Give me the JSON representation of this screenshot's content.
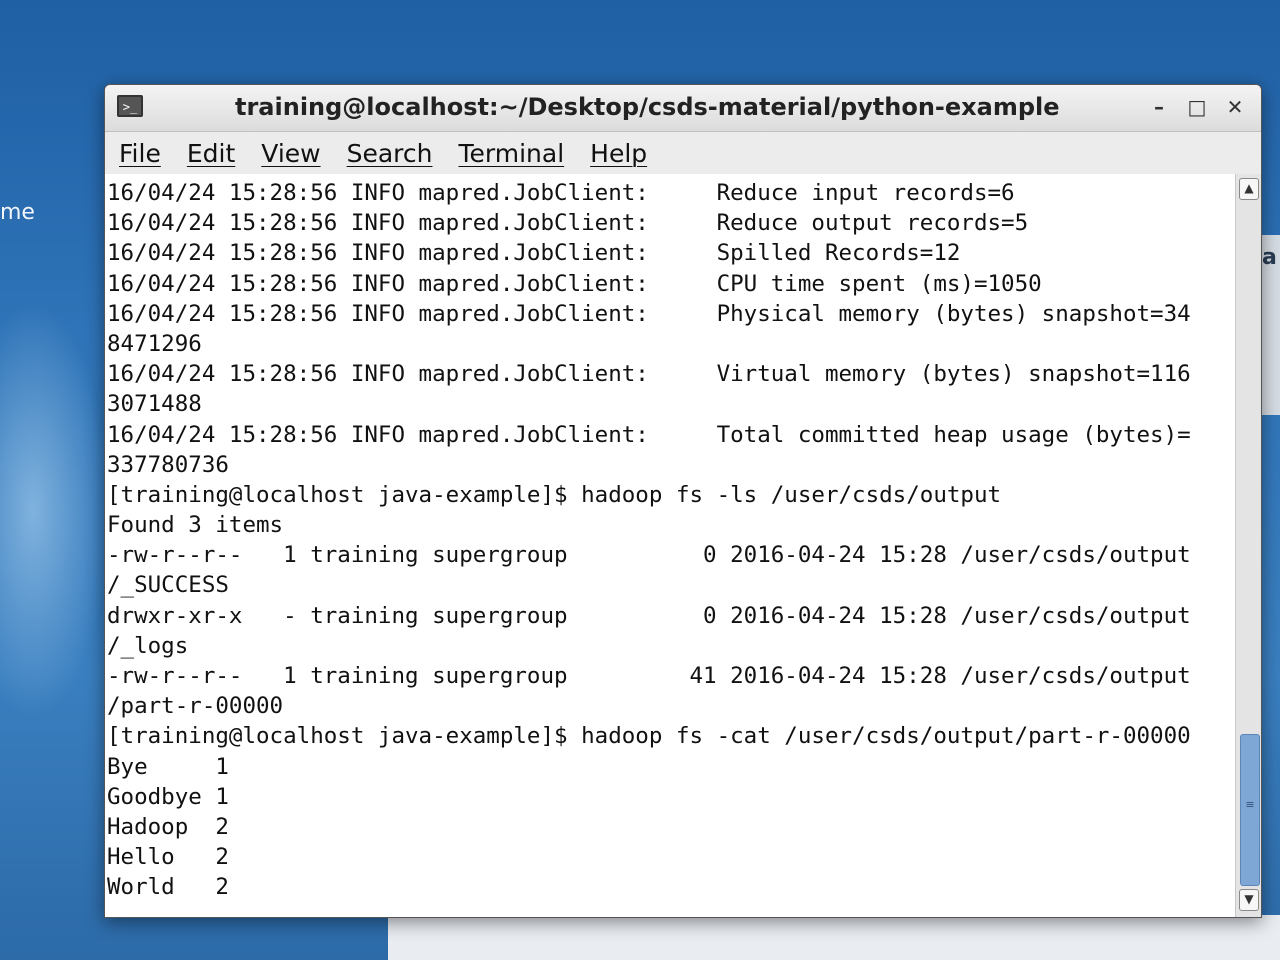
{
  "desktop": {
    "left_text": "me",
    "right_text": "a"
  },
  "window": {
    "title": "training@localhost:~/Desktop/csds-material/python-example",
    "menu": [
      "File",
      "Edit",
      "View",
      "Search",
      "Terminal",
      "Help"
    ],
    "controls": {
      "minimize": "–",
      "maximize": "□",
      "close": "✕"
    }
  },
  "terminal": {
    "lines": [
      "16/04/24 15:28:56 INFO mapred.JobClient:     Reduce input records=6",
      "16/04/24 15:28:56 INFO mapred.JobClient:     Reduce output records=5",
      "16/04/24 15:28:56 INFO mapred.JobClient:     Spilled Records=12",
      "16/04/24 15:28:56 INFO mapred.JobClient:     CPU time spent (ms)=1050",
      "16/04/24 15:28:56 INFO mapred.JobClient:     Physical memory (bytes) snapshot=34",
      "8471296",
      "16/04/24 15:28:56 INFO mapred.JobClient:     Virtual memory (bytes) snapshot=116",
      "3071488",
      "16/04/24 15:28:56 INFO mapred.JobClient:     Total committed heap usage (bytes)=",
      "337780736",
      "[training@localhost java-example]$ hadoop fs -ls /user/csds/output",
      "Found 3 items",
      "-rw-r--r--   1 training supergroup          0 2016-04-24 15:28 /user/csds/output",
      "/_SUCCESS",
      "drwxr-xr-x   - training supergroup          0 2016-04-24 15:28 /user/csds/output",
      "/_logs",
      "-rw-r--r--   1 training supergroup         41 2016-04-24 15:28 /user/csds/output",
      "/part-r-00000",
      "[training@localhost java-example]$ hadoop fs -cat /user/csds/output/part-r-00000",
      "Bye     1",
      "Goodbye 1",
      "Hadoop  2",
      "Hello   2",
      "World   2"
    ]
  },
  "icons": {
    "window_icon": "terminal-icon",
    "scroll_up": "scroll-up-arrow-icon",
    "scroll_down": "scroll-down-arrow-icon"
  }
}
